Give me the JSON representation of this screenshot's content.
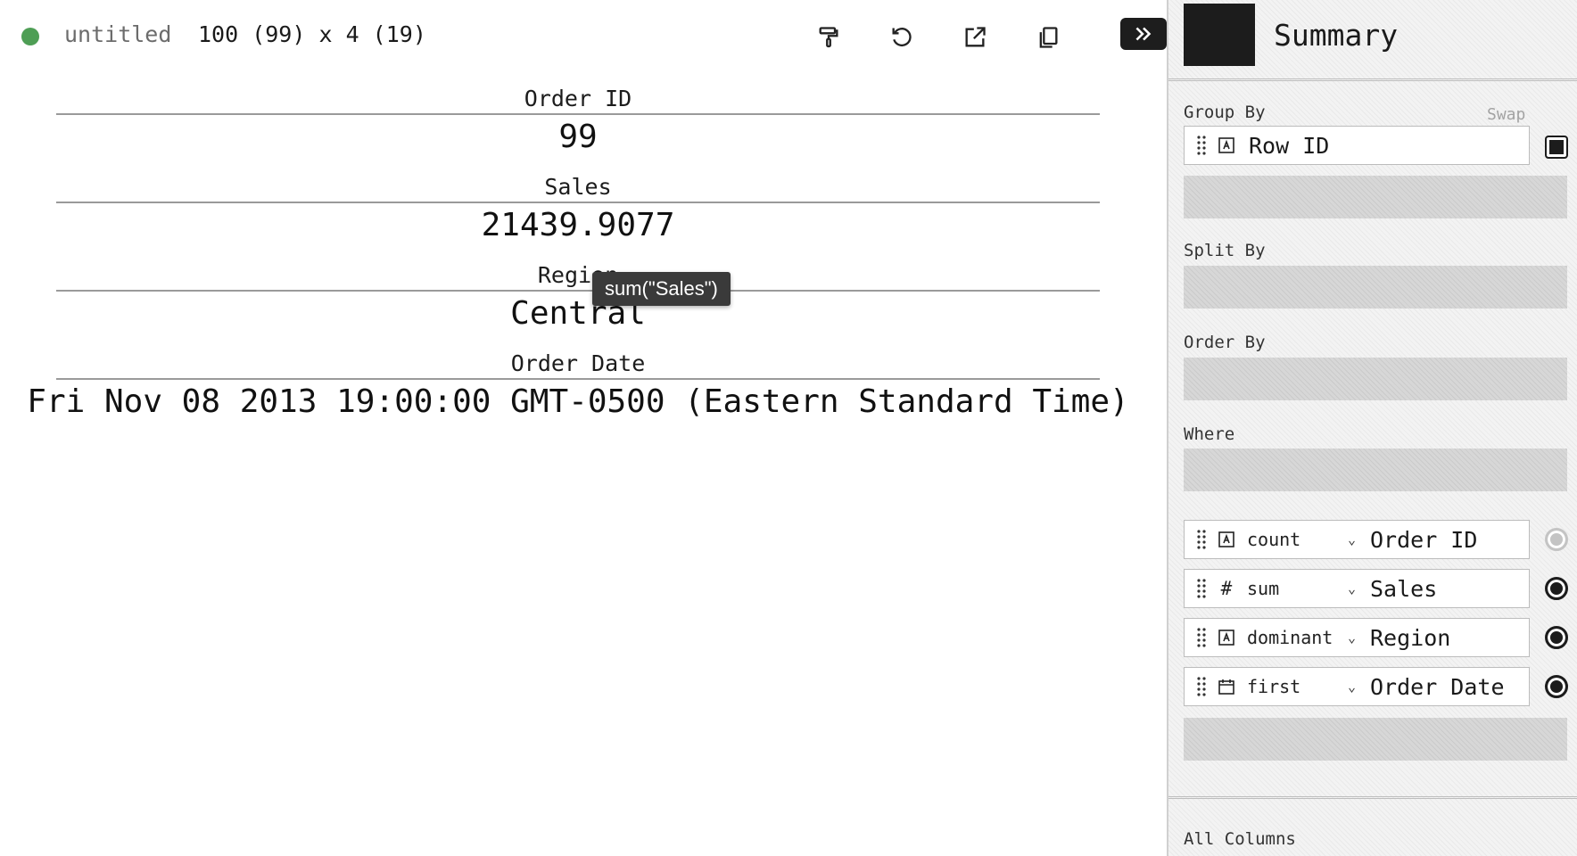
{
  "status": {
    "title": "untitled",
    "dimensions": "100 (99) x 4 (19)"
  },
  "toolbar": {
    "icons": [
      "paint-roller-icon",
      "undo-icon",
      "export-icon",
      "copy-icon"
    ],
    "collapse_icon": "double-chevron-right-icon"
  },
  "records": [
    {
      "label": "Order ID",
      "value": "99"
    },
    {
      "label": "Sales",
      "value": "21439.9077"
    },
    {
      "label": "Region",
      "value": "Central"
    },
    {
      "label": "Order Date",
      "value": "Fri Nov 08 2013 19:00:00 GMT-0500 (Eastern Standard Time)"
    }
  ],
  "tooltip": {
    "text": "sum(\"Sales\")"
  },
  "panel": {
    "plugin_name": "Summary",
    "group_by_label": "Group By",
    "swap_label": "Swap",
    "group_by_column": "Row ID",
    "split_by_label": "Split By",
    "order_by_label": "Order By",
    "where_label": "Where",
    "columns": [
      {
        "type_icon": "string-icon",
        "aggregate": "count",
        "name": "Order ID",
        "active": false
      },
      {
        "type_icon": "number-icon",
        "aggregate": "sum",
        "name": "Sales",
        "active": true
      },
      {
        "type_icon": "string-icon",
        "aggregate": "dominant",
        "name": "Region",
        "active": true
      },
      {
        "type_icon": "calendar-icon",
        "aggregate": "first",
        "name": "Order Date",
        "active": true
      }
    ],
    "all_columns_label": "All Columns"
  },
  "colors": {
    "status_dot": "#4e9e55",
    "accent": "#1c1c1c"
  }
}
